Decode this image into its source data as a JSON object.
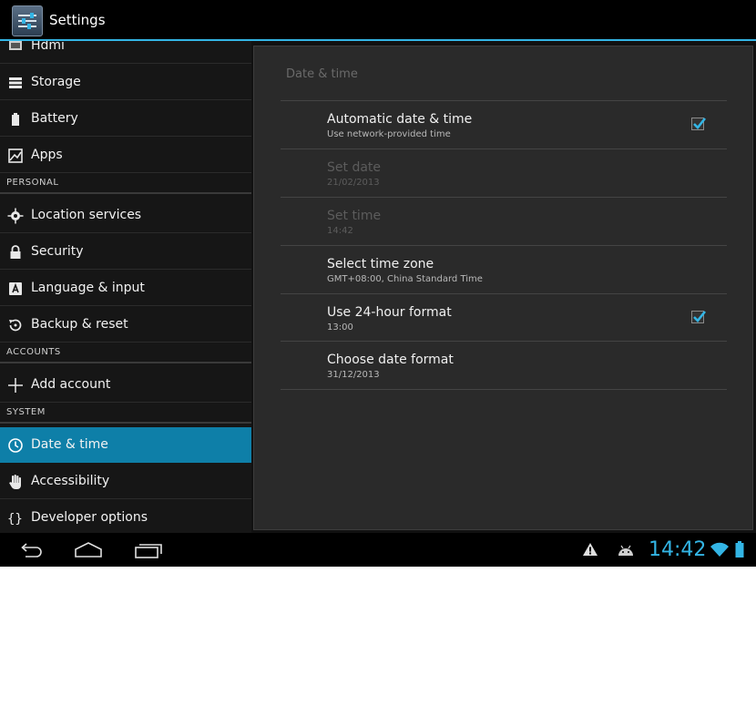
{
  "app": {
    "title": "Settings"
  },
  "sidebar": {
    "items": [
      {
        "label": "Hdmi"
      },
      {
        "label": "Storage"
      },
      {
        "label": "Battery"
      },
      {
        "label": "Apps"
      }
    ],
    "section_personal": "PERSONAL",
    "personal_items": [
      {
        "label": "Location services"
      },
      {
        "label": "Security"
      },
      {
        "label": "Language & input"
      },
      {
        "label": "Backup & reset"
      }
    ],
    "section_accounts": "ACCOUNTS",
    "accounts_items": [
      {
        "label": "Add account"
      }
    ],
    "section_system": "SYSTEM",
    "system_items": [
      {
        "label": "Date & time",
        "selected": true
      },
      {
        "label": "Accessibility"
      },
      {
        "label": "Developer options"
      }
    ]
  },
  "detail": {
    "title": "Date & time",
    "rows": [
      {
        "title": "Automatic date & time",
        "summary": "Use network-provided time",
        "checked": true,
        "enabled": true
      },
      {
        "title": "Set date",
        "summary": "21/02/2013",
        "enabled": false
      },
      {
        "title": "Set time",
        "summary": "14:42",
        "enabled": false
      },
      {
        "title": "Select time zone",
        "summary": "GMT+08:00, China Standard Time",
        "enabled": true
      },
      {
        "title": "Use 24-hour format",
        "summary": "13:00",
        "checked": true,
        "enabled": true
      },
      {
        "title": "Choose date format",
        "summary": "31/12/2013",
        "enabled": true
      }
    ]
  },
  "statusbar": {
    "time": "14:42"
  },
  "colors": {
    "accent": "#33b5e5",
    "selected": "#0e7fa8",
    "background": "#111111"
  },
  "icons": [
    "settings-app-icon",
    "hdmi-icon",
    "storage-icon",
    "battery-icon",
    "apps-icon",
    "location-icon",
    "lock-icon",
    "keyboard-icon",
    "backup-icon",
    "plus-icon",
    "clock-icon",
    "hand-icon",
    "braces-icon",
    "back-icon",
    "home-icon",
    "recents-icon",
    "warning-icon",
    "android-icon",
    "wifi-icon",
    "battery-status-icon"
  ]
}
